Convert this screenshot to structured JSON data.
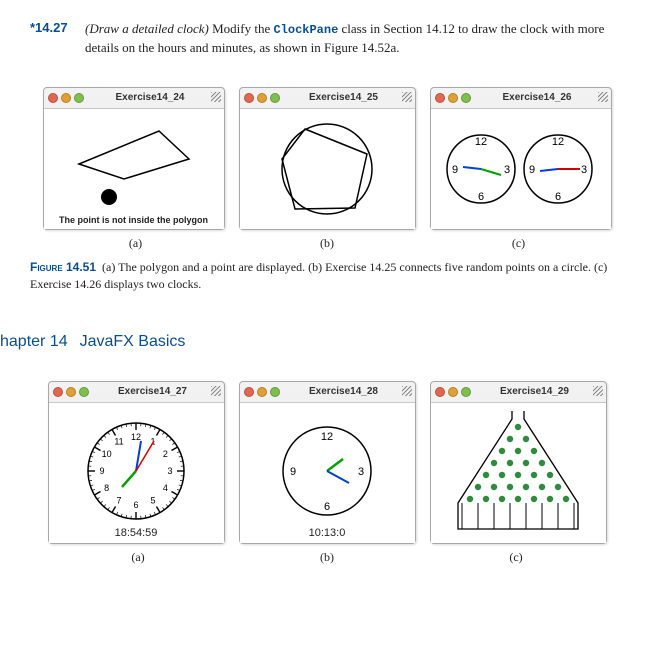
{
  "exercise": {
    "number": "*14.27",
    "title_italic": "(Draw a detailed clock)",
    "body_before": " Modify the ",
    "class_name": "ClockPane",
    "body_after": " class in Section 14.12 to draw the clock with more details on the hours and minutes, as shown in Figure 14.52a."
  },
  "figrow1": {
    "windows": [
      {
        "title": "Exercise14_24",
        "kind": "polygon",
        "status": "The point is not inside the polygon"
      },
      {
        "title": "Exercise14_25",
        "kind": "pentagon"
      },
      {
        "title": "Exercise14_26",
        "kind": "two-clocks"
      }
    ],
    "captions": [
      "(a)",
      "(b)",
      "(c)"
    ]
  },
  "figure51": {
    "label": "Figure 14.51",
    "text": "(a) The polygon and a point are displayed. (b) Exercise 14.25 connects five random points on a circle. (c) Exercise 14.26 displays two clocks."
  },
  "chapter": {
    "num": "hapter 14",
    "title": "JavaFX Basics"
  },
  "figrow2": {
    "windows": [
      {
        "title": "Exercise14_27",
        "kind": "detailed-clock",
        "time": "18:54:59"
      },
      {
        "title": "Exercise14_28",
        "kind": "simple-clock",
        "time": "10:13:0"
      },
      {
        "title": "Exercise14_29",
        "kind": "bean-machine"
      }
    ],
    "captions": [
      "(a)",
      "(b)",
      "(c)"
    ]
  },
  "clock_labels": {
    "n12": "12",
    "n3": "3",
    "n6": "6",
    "n9": "9"
  },
  "detailed_clock_numbers": [
    "12",
    "1",
    "2",
    "3",
    "4",
    "5",
    "6",
    "7",
    "8",
    "9",
    "10",
    "11"
  ]
}
